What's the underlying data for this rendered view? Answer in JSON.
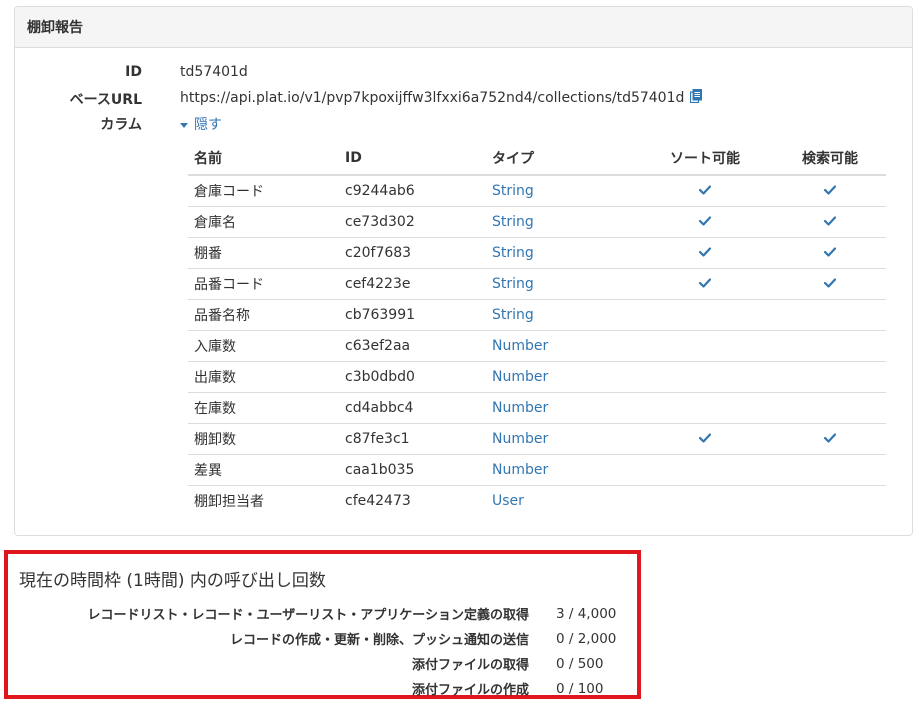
{
  "panel": {
    "title": "棚卸報告",
    "id_label": "ID",
    "id_value": "td57401d",
    "url_label": "ベースURL",
    "url_value": "https://api.plat.io/v1/pvp7kpoxijffw3lfxxi6a752nd4/collections/td57401d",
    "columns_label": "カラム",
    "hide_link": "隠す"
  },
  "table": {
    "headers": [
      "名前",
      "ID",
      "タイプ",
      "ソート可能",
      "検索可能"
    ],
    "rows": [
      {
        "name": "倉庫コード",
        "id": "c9244ab6",
        "type": "String",
        "sortable": true,
        "searchable": true
      },
      {
        "name": "倉庫名",
        "id": "ce73d302",
        "type": "String",
        "sortable": true,
        "searchable": true
      },
      {
        "name": "棚番",
        "id": "c20f7683",
        "type": "String",
        "sortable": true,
        "searchable": true
      },
      {
        "name": "品番コード",
        "id": "cef4223e",
        "type": "String",
        "sortable": true,
        "searchable": true
      },
      {
        "name": "品番名称",
        "id": "cb763991",
        "type": "String",
        "sortable": false,
        "searchable": false
      },
      {
        "name": "入庫数",
        "id": "c63ef2aa",
        "type": "Number",
        "sortable": false,
        "searchable": false
      },
      {
        "name": "出庫数",
        "id": "c3b0dbd0",
        "type": "Number",
        "sortable": false,
        "searchable": false
      },
      {
        "name": "在庫数",
        "id": "cd4abbc4",
        "type": "Number",
        "sortable": false,
        "searchable": false
      },
      {
        "name": "棚卸数",
        "id": "c87fe3c1",
        "type": "Number",
        "sortable": true,
        "searchable": true
      },
      {
        "name": "差異",
        "id": "caa1b035",
        "type": "Number",
        "sortable": false,
        "searchable": false
      },
      {
        "name": "棚卸担当者",
        "id": "cfe42473",
        "type": "User",
        "sortable": false,
        "searchable": false
      }
    ]
  },
  "usage": {
    "title": "現在の時間枠 (1時間) 内の呼び出し回数",
    "rows": [
      {
        "label": "レコードリスト・レコード・ユーザーリスト・アプリケーション定義の取得",
        "value": "3 / 4,000"
      },
      {
        "label": "レコードの作成・更新・削除、プッシュ通知の送信",
        "value": "0 / 2,000"
      },
      {
        "label": "添付ファイルの取得",
        "value": "0 / 500"
      },
      {
        "label": "添付ファイルの作成",
        "value": "0 / 100"
      }
    ]
  },
  "colors": {
    "link": "#3276b1",
    "highlight_border": "#e0161d",
    "check": "#3276b1"
  },
  "icons": {
    "copy": "copy-icon",
    "check": "check-icon",
    "caret": "caret-down-icon"
  }
}
